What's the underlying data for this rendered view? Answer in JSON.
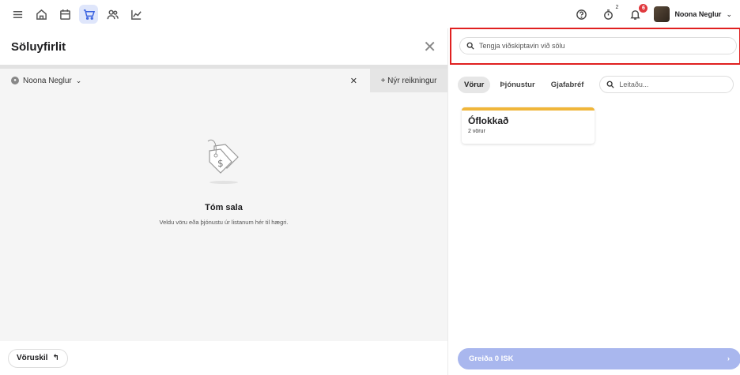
{
  "topbar": {
    "nav_icons": [
      "menu-icon",
      "home-icon",
      "calendar-icon",
      "cart-icon",
      "users-icon",
      "chart-icon"
    ],
    "active_nav": "cart-icon",
    "help_icon": "help-icon",
    "timer_count": "2",
    "notification_count": "6",
    "user_name": "Noona Neglur"
  },
  "left": {
    "title": "Söluyfirlit",
    "customer_tab_label": "Noona Neglur",
    "new_account_label": "+ Nýr reikningur",
    "empty_title": "Tóm sala",
    "empty_subtitle": "Veldu vöru eða þjónustu úr listanum hér til hægri.",
    "return_label": "Vöruskil"
  },
  "right": {
    "customer_search_placeholder": "Tengja viðskiptavin við sölu",
    "categories": [
      "Vörur",
      "Þjónustur",
      "Gjafabréf"
    ],
    "active_category": "Vörur",
    "item_search_placeholder": "Leitaðu...",
    "card": {
      "title": "Óflokkað",
      "subtitle": "2 vörur"
    },
    "pay_label": "Greiða 0 ISK",
    "accent_color": "#f0b63a",
    "pay_color": "#a9b7ee"
  }
}
